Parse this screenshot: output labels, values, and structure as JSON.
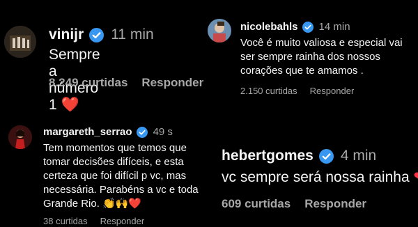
{
  "colors": {
    "background": "#000000",
    "text": "#f5f5f5",
    "muted": "#a8a8a8",
    "verified_badge": "#3897f0",
    "heart": "#ff3040"
  },
  "comments": [
    {
      "username": "vinijr",
      "verified": true,
      "time": "11 min",
      "text": "Sempre a número 1",
      "emoji": "❤️",
      "likes": "8.249 curtidas",
      "reply": "Responder"
    },
    {
      "username": "nicolebahls",
      "verified": true,
      "time": "14 min",
      "text": "Você é muito valiosa e especial vai ser sempre rainha dos nossos corações que te amamos .",
      "likes": "2.150 curtidas",
      "reply": "Responder"
    },
    {
      "username": "margareth_serrao",
      "verified": true,
      "time": "49 s",
      "text": "Tem momentos que temos que tomar decisões difíceis, e esta certeza que foi difícil p vc, mas necessária. Parabéns a vc e toda Grande Rio.",
      "emoji": "👏🙌❤️",
      "likes": "38 curtidas",
      "reply": "Responder"
    },
    {
      "username": "hebertgomes",
      "verified": true,
      "time": "4 min",
      "text": "vc sempre será nossa rainha",
      "emoji": "❤",
      "likes": "609 curtidas",
      "reply": "Responder"
    }
  ]
}
